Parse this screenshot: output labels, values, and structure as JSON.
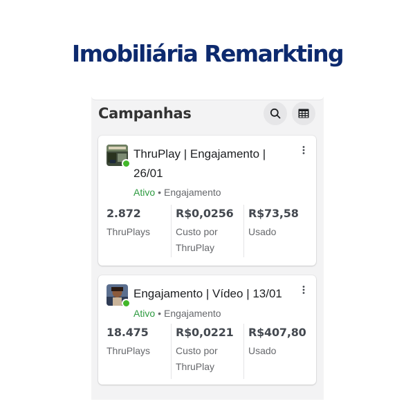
{
  "headline": "Imobiliária Remarkting",
  "section": {
    "title": "Campanhas",
    "search_icon": "search-icon",
    "table_icon": "table-view-icon"
  },
  "colors": {
    "headline": "#0d2a6e",
    "active": "#2c9a3f",
    "status_dot": "#42b72a"
  },
  "campaigns": [
    {
      "title_line1": "ThruPlay | Engajamento |",
      "title_line2": "26/01",
      "status": "Ativo",
      "separator": "•",
      "objective": "Engajamento",
      "menu_icon": "more-vertical-icon",
      "metrics": [
        {
          "value": "2.872",
          "label": "ThruPlays"
        },
        {
          "value": "R$0,0256",
          "label": "Custo por ThruPlay"
        },
        {
          "value": "R$73,58",
          "label": "Usado"
        }
      ]
    },
    {
      "title_line1": "Engajamento | Vídeo | 13/01",
      "status": "Ativo",
      "separator": "•",
      "objective": "Engajamento",
      "menu_icon": "more-vertical-icon",
      "metrics": [
        {
          "value": "18.475",
          "label": "ThruPlays"
        },
        {
          "value": "R$0,0221",
          "label": "Custo por ThruPlay"
        },
        {
          "value": "R$407,80",
          "label": "Usado"
        }
      ]
    }
  ]
}
